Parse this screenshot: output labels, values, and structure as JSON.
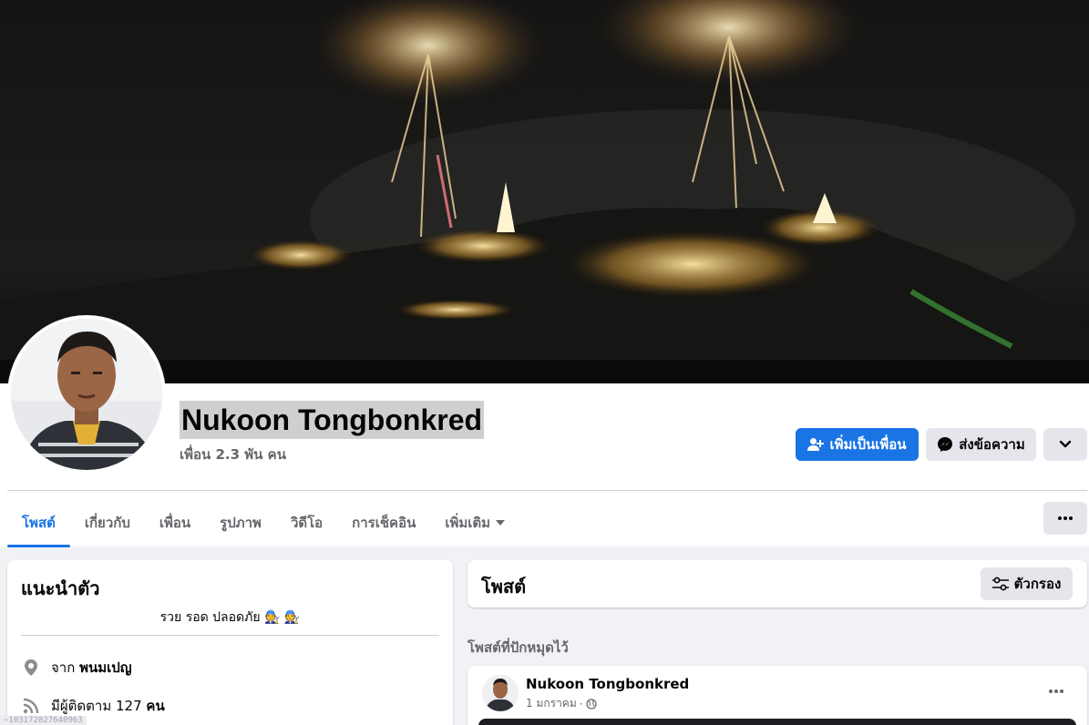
{
  "profile": {
    "name": "Nukoon Tongbonkred",
    "friends": "เพื่อน 2.3 พัน คน"
  },
  "actions": {
    "add_friend": "เพิ่มเป็นเพื่อน",
    "message": "ส่งข้อความ"
  },
  "tabs": [
    {
      "label": "โพสต์",
      "active": true
    },
    {
      "label": "เกี่ยวกับ"
    },
    {
      "label": "เพื่อน"
    },
    {
      "label": "รูปภาพ"
    },
    {
      "label": "วิดีโอ"
    },
    {
      "label": "การเช็คอิน"
    },
    {
      "label": "เพิ่มเติม"
    }
  ],
  "intro": {
    "title": "แนะนำตัว",
    "bio": "รวย รอด ปลอดภัย 🧑‍🔧 🧑‍🔧",
    "from_prefix": "จาก",
    "from_place": "พนมเปญ",
    "followers_prefix": "มีผู้ติดตาม",
    "followers_count": "127",
    "followers_suffix": "คน"
  },
  "posts": {
    "title": "โพสต์",
    "filter": "ตัวกรอง",
    "pinned_label": "โพสต์ที่ปักหมุดไว้",
    "post": {
      "author": "Nukoon Tongbonkred",
      "date": "1 มกราคม",
      "separator": "·"
    }
  },
  "overlay_id": "~103172027640963",
  "colors": {
    "accent": "#1b74e4",
    "button_grey": "#e4e6eb",
    "secondary_text": "#65676b"
  },
  "icons": [
    "add-friend-icon",
    "messenger-icon",
    "chevron-down-icon",
    "more-icon",
    "location-pin-icon",
    "feed-icon",
    "filter-icon",
    "globe-icon"
  ]
}
